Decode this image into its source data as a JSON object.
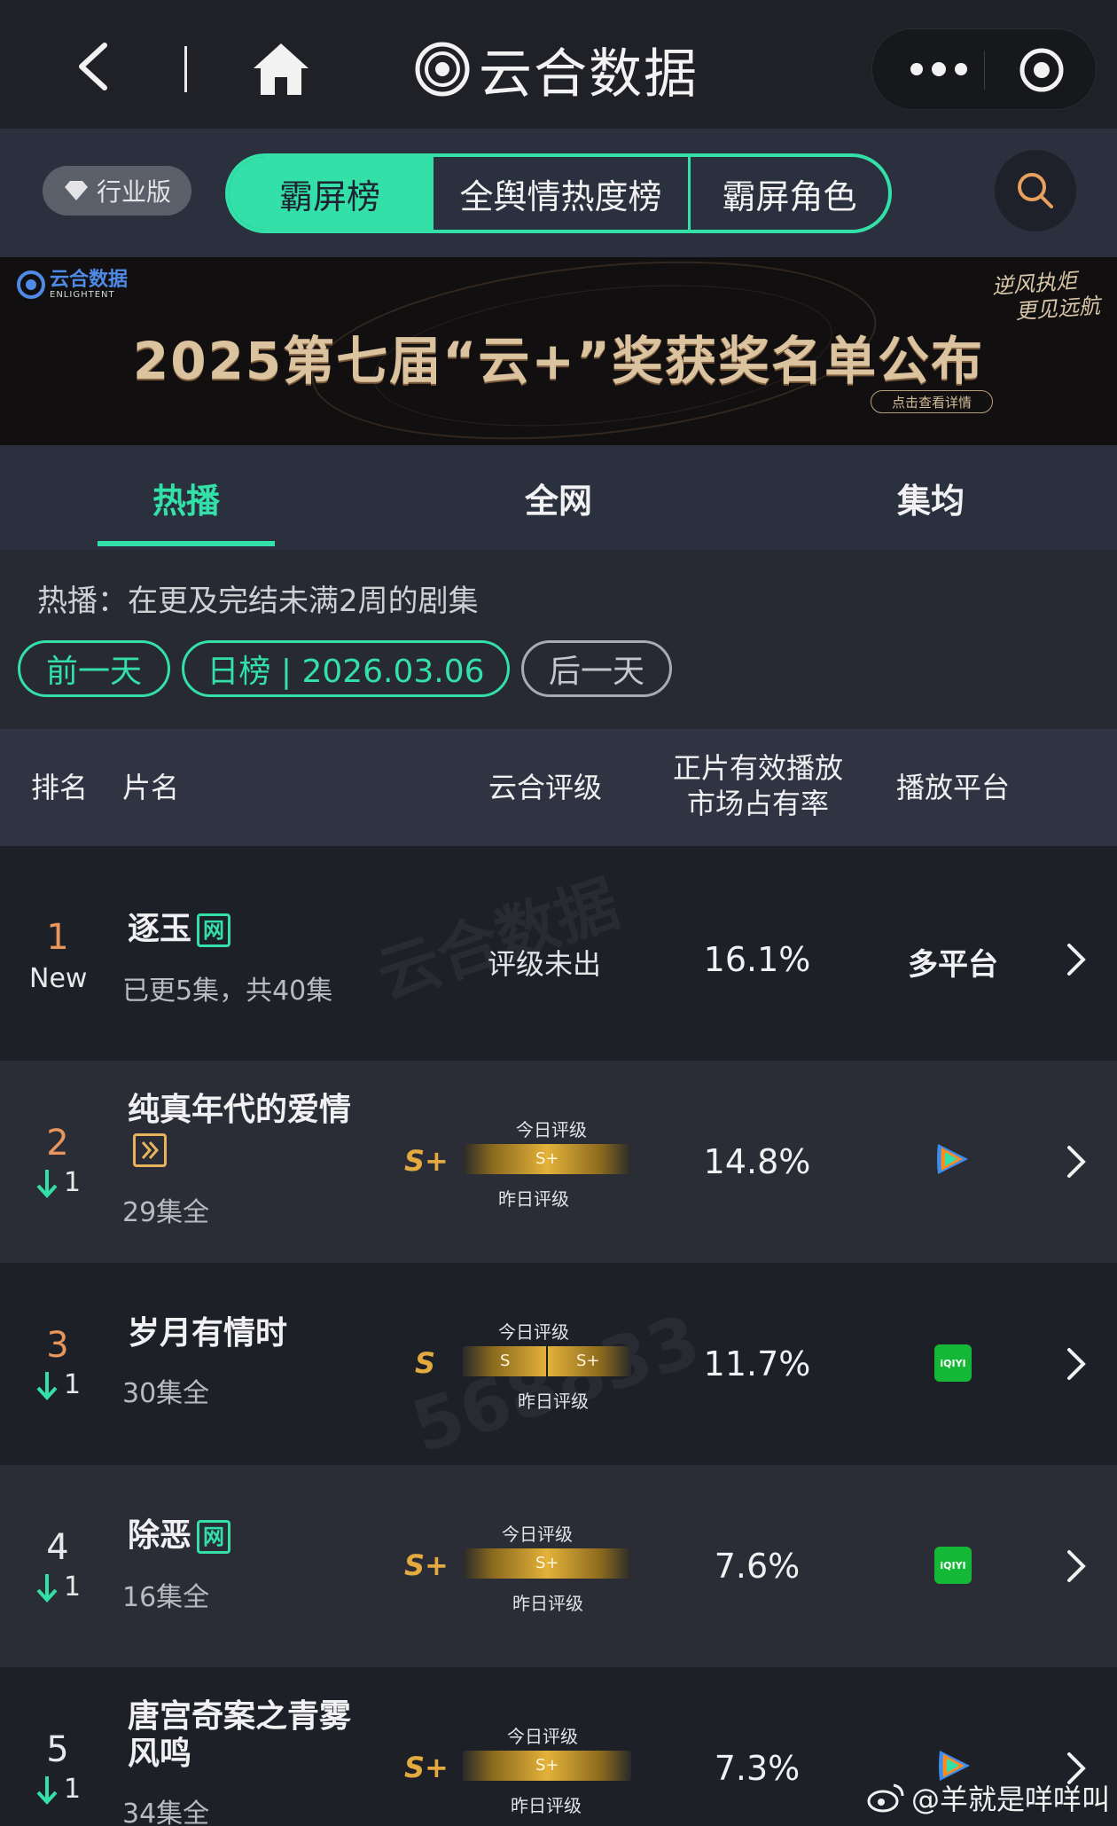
{
  "app": {
    "title": "云合数据"
  },
  "filters": {
    "industry_label": "行业版"
  },
  "tabs": [
    {
      "label": "霸屏榜",
      "active": true
    },
    {
      "label": "全舆情热度榜",
      "active": false
    },
    {
      "label": "霸屏角色",
      "active": false
    }
  ],
  "banner": {
    "logo_text": "云合数据",
    "logo_sub": "ENLIGHTENT",
    "headline": "2025第七届“云+”奖获奖名单公布",
    "detail_label": "点击查看详情",
    "slogan_line1": "逆风执炬",
    "slogan_line2": "更见远航"
  },
  "subtabs": [
    {
      "label": "热播",
      "active": true
    },
    {
      "label": "全网",
      "active": false
    },
    {
      "label": "集均",
      "active": false
    }
  ],
  "info": {
    "description": "热播：在更及完结未满2周的剧集",
    "prev_day": "前一天",
    "date_label": "日榜 | 2026.03.06",
    "next_day": "后一天"
  },
  "table": {
    "headers": {
      "rank": "排名",
      "name": "片名",
      "rating": "云合评级",
      "share_line1": "正片有效播放",
      "share_line2": "市场占有率",
      "platform": "播放平台"
    },
    "today_label": "今日评级",
    "yesterday_label": "昨日评级",
    "rows": [
      {
        "rank": "1",
        "change": "New",
        "title": "逐玉",
        "badge": "网",
        "episodes": "已更5集，共40集",
        "rating": "评级未出",
        "share": "16.1%",
        "platform": "多平台"
      },
      {
        "rank": "2",
        "change": "1",
        "title": "纯真年代的爱情",
        "episodes": "29集全",
        "rating": "S+",
        "bar_labels": [
          "S+"
        ],
        "share": "14.8%",
        "platform": "tencent-video-icon"
      },
      {
        "rank": "3",
        "change": "1",
        "title": "岁月有情时",
        "episodes": "30集全",
        "rating": "S",
        "bar_labels": [
          "S",
          "S+"
        ],
        "share": "11.7%",
        "platform": "iqiyi-icon",
        "platform_text": "iQIYI"
      },
      {
        "rank": "4",
        "change": "1",
        "title": "除恶",
        "badge": "网",
        "episodes": "16集全",
        "rating": "S+",
        "bar_labels": [
          "S+"
        ],
        "share": "7.6%",
        "platform": "iqiyi-icon",
        "platform_text": "iQIYI"
      },
      {
        "rank": "5",
        "change": "1",
        "title_line1": "唐宫奇案之青雾",
        "title_line2": "风鸣",
        "episodes": "34集全",
        "rating": "S+",
        "bar_labels": [
          "S+"
        ],
        "share": "7.3%",
        "platform": "tencent-video-icon"
      }
    ]
  },
  "watermark": {
    "user": "@羊就是咩咩叫"
  },
  "colors": {
    "accent": "#33e0a8",
    "rank_top3": "#e9965e",
    "grade": "#e2aa3f",
    "background": "#1b1d24"
  }
}
